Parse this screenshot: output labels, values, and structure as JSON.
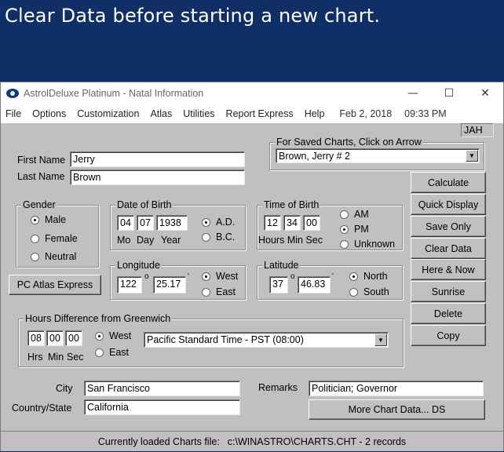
{
  "banner": {
    "text": "Clear Data before starting a new chart."
  },
  "window": {
    "title": "AstrolDeluxe Platinum - Natal Information",
    "controls": {
      "minimize": "—",
      "maximize": "☐",
      "close": "✕"
    }
  },
  "menu": {
    "items": [
      "File",
      "Options",
      "Customization",
      "Atlas",
      "Utilities",
      "Report Express",
      "Help"
    ],
    "date": "Feb 2, 2018",
    "time": "09:33 PM"
  },
  "user_tag": "JAH",
  "saved_charts": {
    "title": "For Saved Charts, Click on Arrow",
    "selected": "Brown, Jerry  # 2"
  },
  "name": {
    "first_label": "First Name",
    "first_value": "Jerry",
    "last_label": "Last Name",
    "last_value": "Brown"
  },
  "gender": {
    "title": "Gender",
    "options": [
      "Male",
      "Female",
      "Neutral"
    ],
    "selected": "Male"
  },
  "dob": {
    "title": "Date of Birth",
    "month": "04",
    "day": "07",
    "year": "1938",
    "labels": [
      "Mo",
      "Day",
      "Year"
    ],
    "era_options": [
      "A.D.",
      "B.C."
    ],
    "era_selected": "A.D."
  },
  "tob": {
    "title": "Time of Birth",
    "hours": "12",
    "min": "34",
    "sec": "00",
    "labels": "Hours Min Sec",
    "options": [
      "AM",
      "PM",
      "Unknown"
    ],
    "selected": "PM"
  },
  "longitude": {
    "title": "Longitude",
    "deg": "122",
    "min": "25.17",
    "options": [
      "West",
      "East"
    ],
    "selected": "West"
  },
  "latitude": {
    "title": "Latitude",
    "deg": "37",
    "min": "46.83",
    "options": [
      "North",
      "South"
    ],
    "selected": "North"
  },
  "atlas_button": "PC Atlas Express",
  "gmt": {
    "title": "Hours Difference from Greenwich",
    "h": "08",
    "m": "00",
    "s": "00",
    "labels": [
      "Hrs",
      "Min",
      "Sec"
    ],
    "options": [
      "West",
      "East"
    ],
    "selected": "West",
    "timezone": "Pacific Standard Time - PST (08:00)"
  },
  "buttons": [
    "Calculate",
    "Quick Display",
    "Save Only",
    "Clear Data",
    "Here & Now",
    "Sunrise",
    "Delete",
    "Copy"
  ],
  "location": {
    "city_label": "City",
    "city_value": "San Francisco",
    "country_label": "Country/State",
    "country_value": "California"
  },
  "remarks": {
    "label": "Remarks",
    "value": "Politician; Governor"
  },
  "more_button": "More Chart Data... DS",
  "status": {
    "prefix": "Currently loaded Charts file:",
    "path": "c:\\WINASTRO\\CHARTS.CHT - 2 records"
  }
}
